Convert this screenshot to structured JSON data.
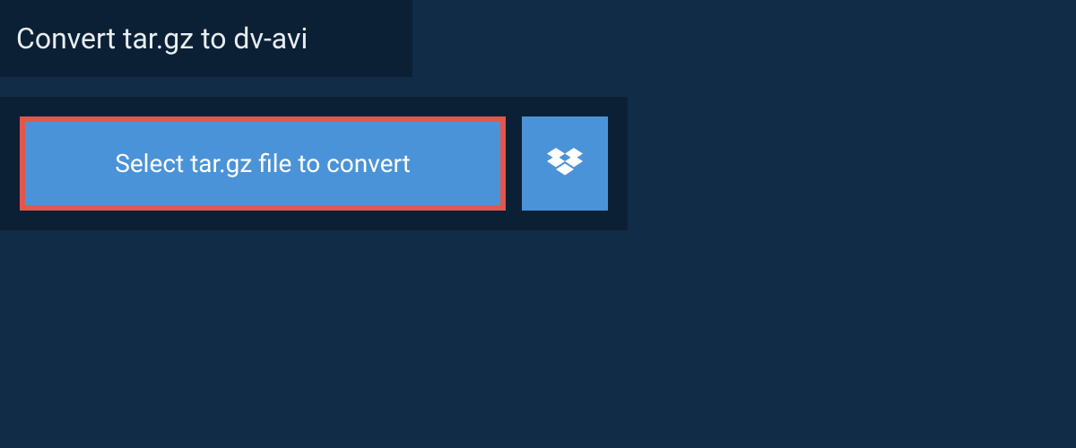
{
  "header": {
    "title": "Convert tar.gz to dv-avi"
  },
  "upload": {
    "select_button_label": "Select tar.gz file to convert"
  }
}
